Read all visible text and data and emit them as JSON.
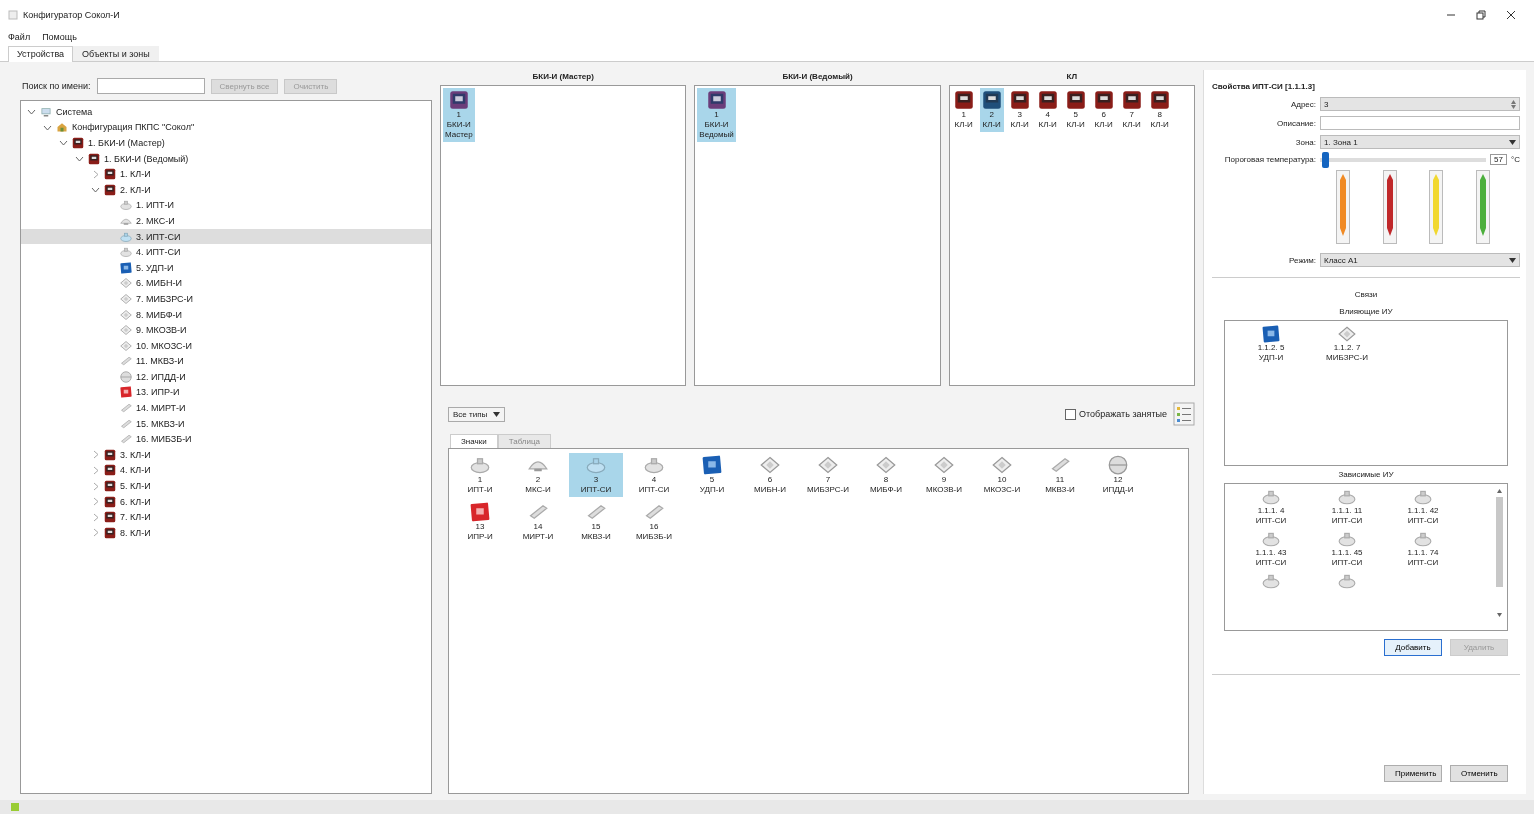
{
  "window": {
    "title": "Конфигуратор Сокол-И"
  },
  "menu": [
    "Файл",
    "Помощь"
  ],
  "tabs": [
    {
      "label": "Устройства",
      "selected": true
    },
    {
      "label": "Объекты и зоны",
      "selected": false
    }
  ],
  "search": {
    "label": "Поиск по имени:",
    "buttons": [
      "Свернуть все",
      "Очистить"
    ]
  },
  "tree": [
    {
      "label": "Система",
      "kind": "system",
      "expanded": true,
      "selected": false,
      "children": [
        {
          "label": "Конфигурация ПКПС \"Сокол\"",
          "kind": "config",
          "expanded": true,
          "selected": false,
          "children": [
            {
              "label": "1. БКИ-И (Мастер)",
              "kind": "unit",
              "expanded": true,
              "selected": false,
              "children": [
                {
                  "label": "1. БКИ-И (Ведомый)",
                  "kind": "unit",
                  "expanded": true,
                  "selected": false,
                  "children": [
                    {
                      "label": "1. КЛ-И",
                      "kind": "unit",
                      "expanded": false,
                      "selected": false
                    },
                    {
                      "label": "2. КЛ-И",
                      "kind": "unit",
                      "expanded": true,
                      "selected": false,
                      "children": [
                        {
                          "label": "1. ИПТ-И",
                          "kind": "detector",
                          "selected": false
                        },
                        {
                          "label": "2. МКС-И",
                          "kind": "dome",
                          "selected": false
                        },
                        {
                          "label": "3. ИПТ-СИ",
                          "kind": "detector_blue",
                          "selected": true
                        },
                        {
                          "label": "4. ИПТ-СИ",
                          "kind": "detector",
                          "selected": false
                        },
                        {
                          "label": "5. УДП-И",
                          "kind": "blue_square",
                          "selected": false
                        },
                        {
                          "label": "6. МИБН-И",
                          "kind": "diamond",
                          "selected": false
                        },
                        {
                          "label": "7. МИБЗРС-И",
                          "kind": "diamond",
                          "selected": false
                        },
                        {
                          "label": "8. МИБФ-И",
                          "kind": "diamond",
                          "selected": false
                        },
                        {
                          "label": "9. МКОЗВ-И",
                          "kind": "diamond",
                          "selected": false
                        },
                        {
                          "label": "10. МКОЗС-И",
                          "kind": "diamond",
                          "selected": false
                        },
                        {
                          "label": "11. МКВЗ-И",
                          "kind": "bar",
                          "selected": false
                        },
                        {
                          "label": "12. ИПДД-И",
                          "kind": "sphere",
                          "selected": false
                        },
                        {
                          "label": "13. ИПР-И",
                          "kind": "red_square",
                          "selected": false
                        },
                        {
                          "label": "14. МИРТ-И",
                          "kind": "bar",
                          "selected": false
                        },
                        {
                          "label": "15. МКВЗ-И",
                          "kind": "bar",
                          "selected": false
                        },
                        {
                          "label": "16. МИБЗБ-И",
                          "kind": "bar",
                          "selected": false
                        }
                      ]
                    },
                    {
                      "label": "3. КЛ-И",
                      "kind": "unit",
                      "expanded": false,
                      "selected": false
                    },
                    {
                      "label": "4. КЛ-И",
                      "kind": "unit",
                      "expanded": false,
                      "selected": false
                    },
                    {
                      "label": "5. КЛ-И",
                      "kind": "unit",
                      "expanded": false,
                      "selected": false
                    },
                    {
                      "label": "6. КЛ-И",
                      "kind": "unit",
                      "expanded": false,
                      "selected": false
                    },
                    {
                      "label": "7. КЛ-И",
                      "kind": "unit",
                      "expanded": false,
                      "selected": false
                    },
                    {
                      "label": "8. КЛ-И",
                      "kind": "unit",
                      "expanded": false,
                      "selected": false
                    }
                  ]
                }
              ]
            }
          ]
        }
      ]
    }
  ],
  "panels": [
    {
      "title": "БКИ-И (Мастер)",
      "items": [
        {
          "number": "1",
          "name": "БКИ-И",
          "note": "Мастер",
          "kind": "bki",
          "selected": true
        }
      ]
    },
    {
      "title": "БКИ-И (Ведомый)",
      "items": [
        {
          "number": "1",
          "name": "БКИ-И",
          "note": "Ведомый",
          "kind": "bki",
          "selected": true
        }
      ]
    },
    {
      "title": "КЛ",
      "items": [
        {
          "number": "1",
          "name": "КЛ-И",
          "kind": "unit",
          "selected": false
        },
        {
          "number": "2",
          "name": "КЛ-И",
          "kind": "unit_blue",
          "selected": true
        },
        {
          "number": "3",
          "name": "КЛ-И",
          "kind": "unit",
          "selected": false
        },
        {
          "number": "4",
          "name": "КЛ-И",
          "kind": "unit",
          "selected": false
        },
        {
          "number": "5",
          "name": "КЛ-И",
          "kind": "unit",
          "selected": false
        },
        {
          "number": "6",
          "name": "КЛ-И",
          "kind": "unit",
          "selected": false
        },
        {
          "number": "7",
          "name": "КЛ-И",
          "kind": "unit",
          "selected": false
        },
        {
          "number": "8",
          "name": "КЛ-И",
          "kind": "unit",
          "selected": false
        }
      ]
    }
  ],
  "palette": {
    "filter": "Все типы",
    "show_busy": {
      "label": "Отображать занятые",
      "checked": false
    },
    "tabs": [
      {
        "label": "Значки",
        "selected": true
      },
      {
        "label": "Таблица",
        "selected": false
      }
    ],
    "items": [
      {
        "number": "1",
        "name": "ИПТ-И",
        "kind": "detector",
        "selected": false
      },
      {
        "number": "2",
        "name": "МКС-И",
        "kind": "dome",
        "selected": false
      },
      {
        "number": "3",
        "name": "ИПТ-СИ",
        "kind": "detector_blue",
        "selected": true
      },
      {
        "number": "4",
        "name": "ИПТ-СИ",
        "kind": "detector",
        "selected": false
      },
      {
        "number": "5",
        "name": "УДП-И",
        "kind": "blue_square",
        "selected": false
      },
      {
        "number": "6",
        "name": "МИБН-И",
        "kind": "diamond",
        "selected": false
      },
      {
        "number": "7",
        "name": "МИБЗРС-И",
        "kind": "diamond",
        "selected": false
      },
      {
        "number": "8",
        "name": "МИБФ-И",
        "kind": "diamond",
        "selected": false
      },
      {
        "number": "9",
        "name": "МКОЗВ-И",
        "kind": "diamond",
        "selected": false
      },
      {
        "number": "10",
        "name": "МКОЗС-И",
        "kind": "diamond",
        "selected": false
      },
      {
        "number": "11",
        "name": "МКВЗ-И",
        "kind": "bar",
        "selected": false
      },
      {
        "number": "12",
        "name": "ИПДД-И",
        "kind": "sphere",
        "selected": false
      },
      {
        "number": "13",
        "name": "ИПР-И",
        "kind": "red_square",
        "selected": false
      },
      {
        "number": "14",
        "name": "МИРТ-И",
        "kind": "bar",
        "selected": false
      },
      {
        "number": "15",
        "name": "МКВЗ-И",
        "kind": "bar",
        "selected": false
      },
      {
        "number": "16",
        "name": "МИБЗБ-И",
        "kind": "bar",
        "selected": false
      }
    ]
  },
  "properties": {
    "title": "Свойства ИПТ-СИ [1.1.1.3]",
    "fields": [
      {
        "label": "Адрес:",
        "kind": "spin",
        "value": "3"
      },
      {
        "label": "Описание:",
        "kind": "text"
      },
      {
        "label": "Зона:",
        "kind": "combo",
        "value": "1. Зона 1"
      },
      {
        "label": "Пороговая температура:",
        "kind": "slider",
        "level": 0.02,
        "value": "57",
        "unit": "°С"
      },
      {
        "label": "Режим:",
        "kind": "combo",
        "value": "Класс А1"
      }
    ],
    "links": {
      "title": "Связи",
      "influencing": {
        "title": "Влияющие ИУ",
        "items": [
          {
            "address": "1.1.2. 5",
            "name": "УДП-И",
            "kind": "blue_square"
          },
          {
            "address": "1.1.2. 7",
            "name": "МИБЗРС-И",
            "kind": "diamond"
          }
        ]
      },
      "dependent": {
        "title": "Зависимые ИУ",
        "items": [
          {
            "address": "1.1.1. 4",
            "name": "ИПТ-СИ",
            "kind": "detector"
          },
          {
            "address": "1.1.1. 11",
            "name": "ИПТ-СИ",
            "kind": "detector"
          },
          {
            "address": "1.1.1. 42",
            "name": "ИПТ-СИ",
            "kind": "detector"
          },
          {
            "address": "1.1.1. 43",
            "name": "ИПТ-СИ",
            "kind": "detector"
          },
          {
            "address": "1.1.1. 45",
            "name": "ИПТ-СИ",
            "kind": "detector"
          },
          {
            "address": "1.1.1. 74",
            "name": "ИПТ-СИ",
            "kind": "detector"
          },
          {
            "kind": "detector"
          },
          {
            "kind": "detector"
          }
        ]
      },
      "buttons": [
        {
          "label": "Добавить",
          "disabled": false
        },
        {
          "label": "Удалить",
          "disabled": true
        }
      ]
    },
    "buttons": [
      "Применить",
      "Отменить"
    ]
  }
}
